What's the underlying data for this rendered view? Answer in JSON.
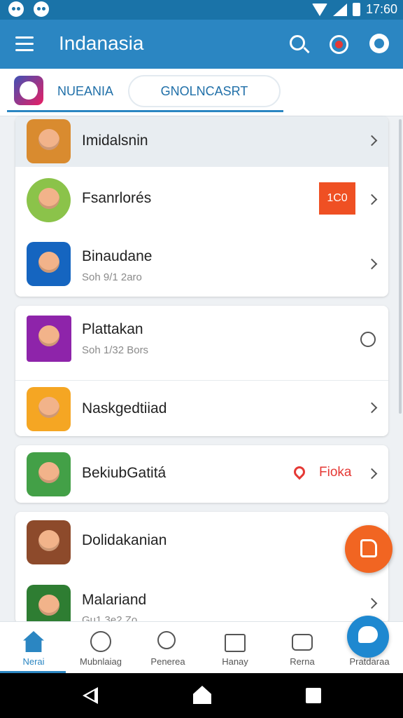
{
  "status_bar": {
    "time": "17:60"
  },
  "app_bar": {
    "title": "Indanasia"
  },
  "tabs": [
    {
      "label": "NUEANIA"
    },
    {
      "label": "GNOLNCASRT"
    }
  ],
  "groups": [
    {
      "items": [
        {
          "title": "Imidalsnin",
          "subtitle": "",
          "icon": "game-icon-warrior",
          "trailing": "chevron-right",
          "highlight": true,
          "color": "#d98b2f"
        },
        {
          "title": "Fsanrlorés",
          "subtitle": "",
          "icon": "game-icon-badge",
          "trailing": "chevron-right",
          "badge": "1C0",
          "color": "#8bc34a"
        },
        {
          "title": "Binaudane",
          "subtitle": "Soh 9/1 2aro",
          "icon": "game-icon-baby",
          "trailing": "chevron-right",
          "color": "#1565c0"
        }
      ]
    },
    {
      "items": [
        {
          "title": "Plattakan",
          "subtitle": "Soh 1/32 Bors",
          "icon": "game-icon-fighter",
          "trailing": "circle",
          "color": "#8e24aa"
        },
        {
          "title": "Naskgedtiiad",
          "subtitle": "",
          "icon": "game-icon-monkey",
          "trailing": "chevron-right",
          "color": "#f5a623"
        }
      ]
    },
    {
      "items": [
        {
          "title": "BekiubGatitá",
          "subtitle": "",
          "icon": "game-icon-blocks",
          "trailing": "chevron-right",
          "pin_label": "Fioka",
          "color": "#43a047"
        }
      ]
    },
    {
      "items": [
        {
          "title": "Dolidakanian",
          "subtitle": "",
          "icon": "game-icon-lion",
          "trailing": "",
          "color": "#8d4a2b"
        },
        {
          "title": "Malariand",
          "subtitle": "Gu1 3e2 Zo",
          "icon": "game-icon-heroine",
          "trailing": "chevron-right",
          "color": "#2e7d32"
        }
      ]
    }
  ],
  "bottom_nav": [
    {
      "label": "Nerai",
      "icon": "home-icon",
      "active": true
    },
    {
      "label": "Mubnlaiag",
      "icon": "face-icon"
    },
    {
      "label": "Penerea",
      "icon": "bulb-icon"
    },
    {
      "label": "Hanay",
      "icon": "bag-icon"
    },
    {
      "label": "Rerna",
      "icon": "wallet-icon"
    },
    {
      "label": "Pratdaraa",
      "icon": "chat-icon"
    }
  ],
  "colors": {
    "primary": "#2b86c2",
    "accent": "#f16522",
    "badge": "#ef5023"
  }
}
